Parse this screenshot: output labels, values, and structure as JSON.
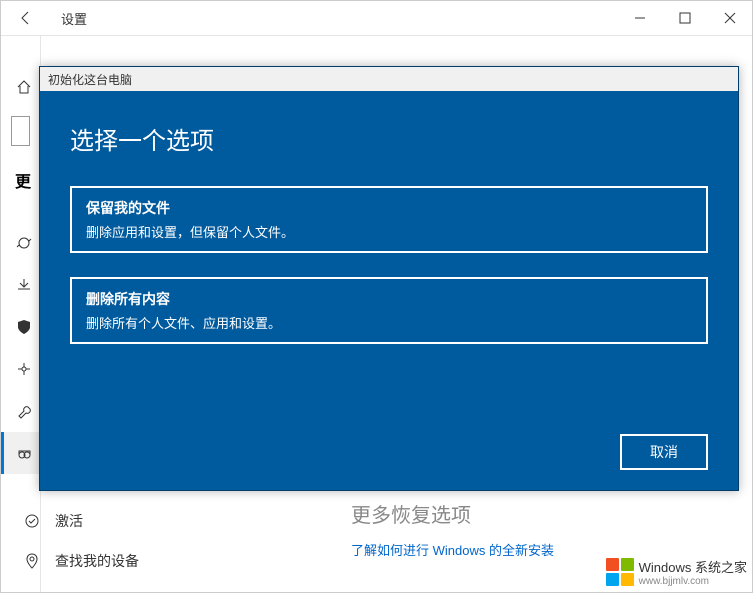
{
  "window": {
    "title": "设置"
  },
  "sidebar_bottom": {
    "activate": "激活",
    "find_device": "查找我的设备"
  },
  "main": {
    "recovery_heading": "更多恢复选项",
    "recovery_link": "了解如何进行 Windows 的全新安装"
  },
  "modal": {
    "titlebar": "初始化这台电脑",
    "heading": "选择一个选项",
    "option1": {
      "title": "保留我的文件",
      "desc": "删除应用和设置，但保留个人文件。"
    },
    "option2": {
      "title": "删除所有内容",
      "desc": "删除所有个人文件、应用和设置。"
    },
    "cancel": "取消"
  },
  "watermark": {
    "text": "Windows 系统之家",
    "url": "www.bjjmlv.com"
  },
  "truncated_left": "更"
}
